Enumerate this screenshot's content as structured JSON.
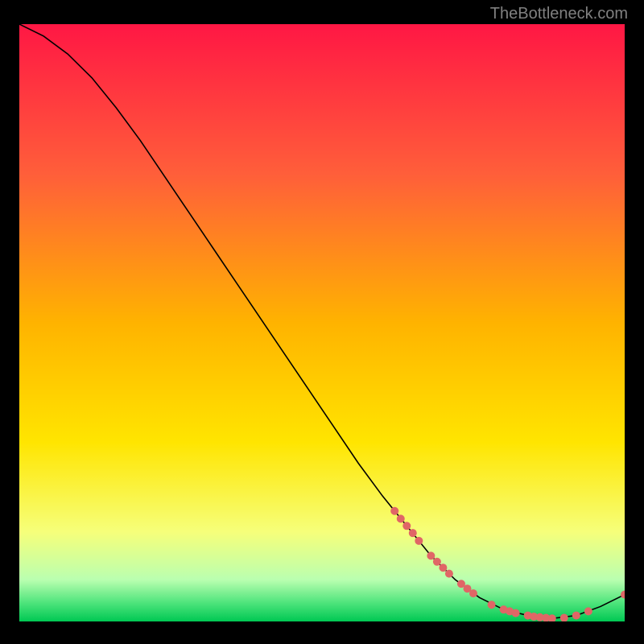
{
  "watermark": "TheBottleneck.com",
  "chart_data": {
    "type": "line",
    "title": "",
    "xlabel": "",
    "ylabel": "",
    "xlim": [
      0,
      100
    ],
    "ylim": [
      0,
      100
    ],
    "gradient_stops": [
      {
        "offset": 0,
        "color": "#ff1744"
      },
      {
        "offset": 25,
        "color": "#ff5e3a"
      },
      {
        "offset": 50,
        "color": "#ffb300"
      },
      {
        "offset": 70,
        "color": "#ffe500"
      },
      {
        "offset": 85,
        "color": "#f6ff7a"
      },
      {
        "offset": 93,
        "color": "#baffb0"
      },
      {
        "offset": 97,
        "color": "#4be37a"
      },
      {
        "offset": 100,
        "color": "#00c853"
      }
    ],
    "series": [
      {
        "name": "bottleneck-curve",
        "x": [
          0,
          4,
          8,
          12,
          16,
          20,
          24,
          28,
          32,
          36,
          40,
          44,
          48,
          52,
          56,
          60,
          64,
          68,
          72,
          76,
          80,
          84,
          88,
          92,
          96,
          100
        ],
        "y": [
          100,
          98,
          95,
          91,
          86,
          80.5,
          74.5,
          68.5,
          62.5,
          56.5,
          50.5,
          44.5,
          38.5,
          32.5,
          26.5,
          21,
          16,
          11,
          7,
          4,
          2,
          1,
          0.5,
          1,
          2.5,
          4.5
        ]
      }
    ],
    "highlight_points": {
      "name": "marked-range",
      "color": "#e06666",
      "points": [
        {
          "x": 62,
          "y": 18.5
        },
        {
          "x": 63,
          "y": 17.2
        },
        {
          "x": 64,
          "y": 16
        },
        {
          "x": 65,
          "y": 14.8
        },
        {
          "x": 66,
          "y": 13.5
        },
        {
          "x": 68,
          "y": 11
        },
        {
          "x": 69,
          "y": 10
        },
        {
          "x": 70,
          "y": 9
        },
        {
          "x": 71,
          "y": 8
        },
        {
          "x": 73,
          "y": 6.3
        },
        {
          "x": 74,
          "y": 5.5
        },
        {
          "x": 75,
          "y": 4.7
        },
        {
          "x": 78,
          "y": 2.8
        },
        {
          "x": 80,
          "y": 2
        },
        {
          "x": 81,
          "y": 1.7
        },
        {
          "x": 82,
          "y": 1.4
        },
        {
          "x": 84,
          "y": 1
        },
        {
          "x": 85,
          "y": 0.8
        },
        {
          "x": 86,
          "y": 0.7
        },
        {
          "x": 87,
          "y": 0.6
        },
        {
          "x": 88,
          "y": 0.5
        },
        {
          "x": 90,
          "y": 0.6
        },
        {
          "x": 92,
          "y": 1
        },
        {
          "x": 94,
          "y": 1.7
        },
        {
          "x": 100,
          "y": 4.5
        }
      ]
    }
  }
}
